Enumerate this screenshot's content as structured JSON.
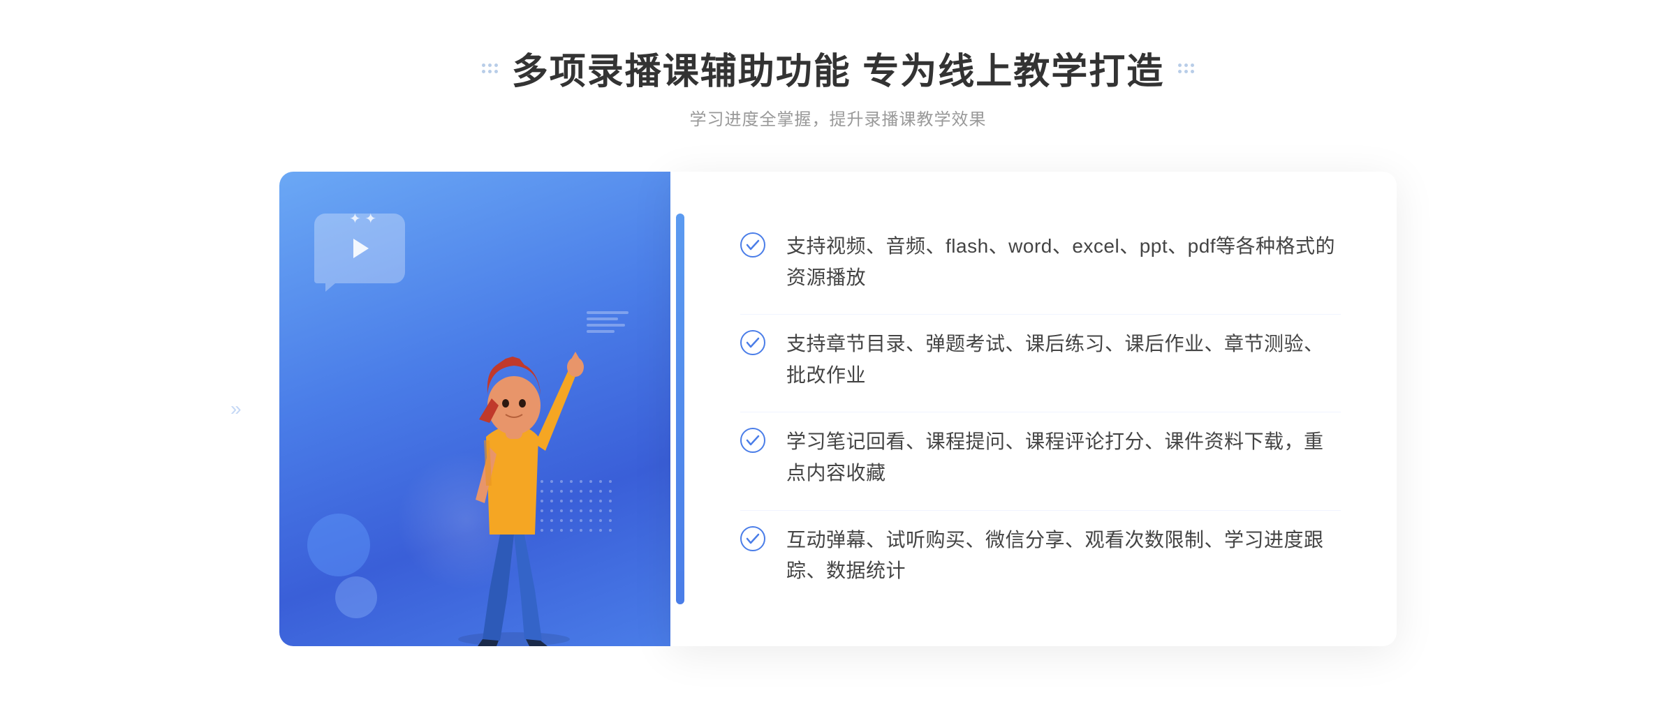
{
  "header": {
    "title": "多项录播课辅助功能 专为线上教学打造",
    "subtitle": "学习进度全掌握，提升录播课教学效果"
  },
  "features": [
    {
      "id": 1,
      "text": "支持视频、音频、flash、word、excel、ppt、pdf等各种格式的资源播放"
    },
    {
      "id": 2,
      "text": "支持章节目录、弹题考试、课后练习、课后作业、章节测验、批改作业"
    },
    {
      "id": 3,
      "text": "学习笔记回看、课程提问、课程评论打分、课件资料下载，重点内容收藏"
    },
    {
      "id": 4,
      "text": "互动弹幕、试听购买、微信分享、观看次数限制、学习进度跟踪、数据统计"
    }
  ],
  "decoration": {
    "check_icon_color": "#4a7de8",
    "accent_color": "#4a7de8",
    "light_bg": "#f0f6ff"
  }
}
